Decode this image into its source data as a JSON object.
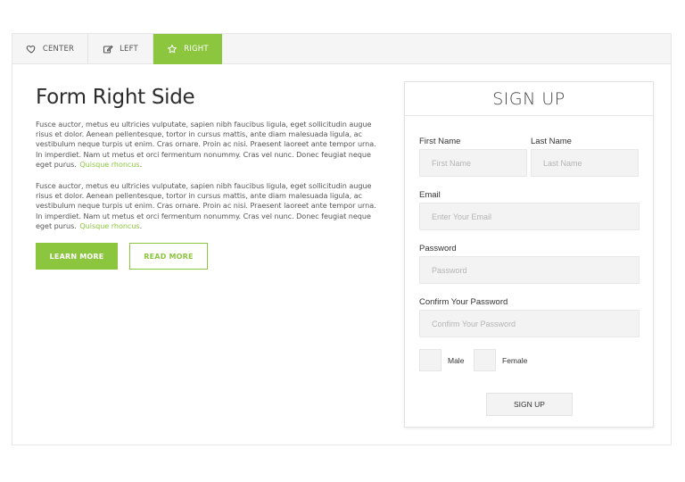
{
  "colors": {
    "accent": "#8cc63f",
    "tab_bg": "#f5f5f5"
  },
  "tabs": [
    {
      "label": "CENTER",
      "icon": "heart-icon",
      "active": false
    },
    {
      "label": "LEFT",
      "icon": "edit-icon",
      "active": false
    },
    {
      "label": "RIGHT",
      "icon": "star-icon",
      "active": true
    }
  ],
  "content": {
    "title": "Form Right Side",
    "paragraphs": [
      {
        "text": "Fusce auctor, metus eu ultricies vulputate, sapien nibh faucibus ligula, eget sollicitudin augue risus et dolor. Aenean pellentesque, tortor in cursus mattis, ante diam malesuada ligula, ac vestibulum neque turpis ut enim. Cras ornare. Proin ac nisi. Praesent laoreet ante tempor urna. In imperdiet. Nam ut metus et orci fermentum nonummy. Cras vel nunc. Donec feugiat neque eget purus.",
        "link": "Quisque rhoncus",
        "suffix": "."
      },
      {
        "text": "Fusce auctor, metus eu ultricies vulputate, sapien nibh faucibus ligula, eget sollicitudin augue risus et dolor. Aenean pellentesque, tortor in cursus mattis, ante diam malesuada ligula, ac vestibulum neque turpis ut enim. Cras ornare. Proin ac nisi. Praesent laoreet ante tempor urna. In imperdiet. Nam ut metus et orci fermentum nonummy. Cras vel nunc. Donec feugiat neque eget purus.",
        "link": "Quisque rhoncus",
        "suffix": "."
      }
    ],
    "learn_more": "LEARN MORE",
    "read_more": "READ MORE"
  },
  "form": {
    "title": "SIGN UP",
    "first_name": {
      "label": "First Name",
      "value": "",
      "placeholder": "First Name"
    },
    "last_name": {
      "label": "Last Name",
      "value": "",
      "placeholder": "Last Name"
    },
    "email": {
      "label": "Email",
      "value": "",
      "placeholder": "Enter Your Email"
    },
    "password": {
      "label": "Password",
      "value": "",
      "placeholder": "Password"
    },
    "confirm_password": {
      "label": "Confirm Your Password",
      "value": "",
      "placeholder": "Confirm Your Password"
    },
    "gender_male": "Male",
    "gender_female": "Female",
    "submit": "SIGN UP"
  }
}
